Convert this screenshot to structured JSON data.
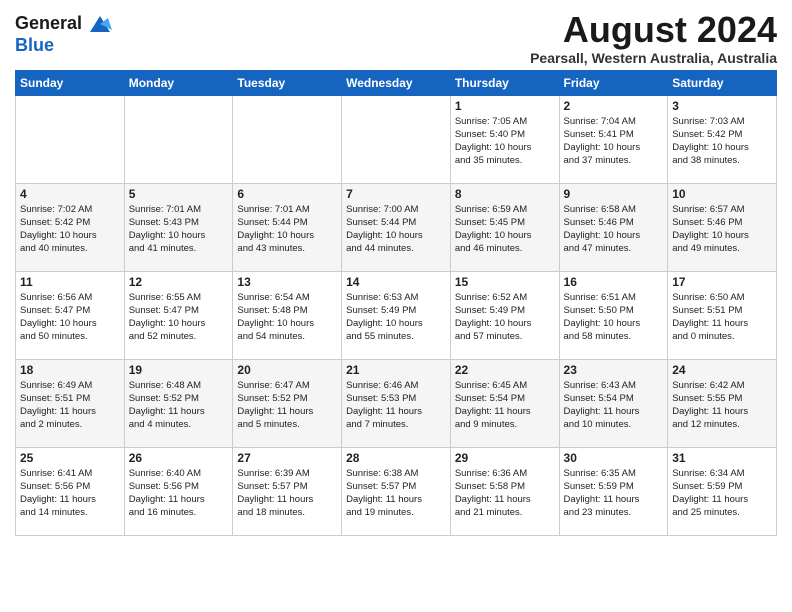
{
  "header": {
    "logo_line1": "General",
    "logo_line2": "Blue",
    "title": "August 2024",
    "subtitle": "Pearsall, Western Australia, Australia"
  },
  "days_of_week": [
    "Sunday",
    "Monday",
    "Tuesday",
    "Wednesday",
    "Thursday",
    "Friday",
    "Saturday"
  ],
  "weeks": [
    [
      {
        "day": "",
        "info": ""
      },
      {
        "day": "",
        "info": ""
      },
      {
        "day": "",
        "info": ""
      },
      {
        "day": "",
        "info": ""
      },
      {
        "day": "1",
        "info": "Sunrise: 7:05 AM\nSunset: 5:40 PM\nDaylight: 10 hours\nand 35 minutes."
      },
      {
        "day": "2",
        "info": "Sunrise: 7:04 AM\nSunset: 5:41 PM\nDaylight: 10 hours\nand 37 minutes."
      },
      {
        "day": "3",
        "info": "Sunrise: 7:03 AM\nSunset: 5:42 PM\nDaylight: 10 hours\nand 38 minutes."
      }
    ],
    [
      {
        "day": "4",
        "info": "Sunrise: 7:02 AM\nSunset: 5:42 PM\nDaylight: 10 hours\nand 40 minutes."
      },
      {
        "day": "5",
        "info": "Sunrise: 7:01 AM\nSunset: 5:43 PM\nDaylight: 10 hours\nand 41 minutes."
      },
      {
        "day": "6",
        "info": "Sunrise: 7:01 AM\nSunset: 5:44 PM\nDaylight: 10 hours\nand 43 minutes."
      },
      {
        "day": "7",
        "info": "Sunrise: 7:00 AM\nSunset: 5:44 PM\nDaylight: 10 hours\nand 44 minutes."
      },
      {
        "day": "8",
        "info": "Sunrise: 6:59 AM\nSunset: 5:45 PM\nDaylight: 10 hours\nand 46 minutes."
      },
      {
        "day": "9",
        "info": "Sunrise: 6:58 AM\nSunset: 5:46 PM\nDaylight: 10 hours\nand 47 minutes."
      },
      {
        "day": "10",
        "info": "Sunrise: 6:57 AM\nSunset: 5:46 PM\nDaylight: 10 hours\nand 49 minutes."
      }
    ],
    [
      {
        "day": "11",
        "info": "Sunrise: 6:56 AM\nSunset: 5:47 PM\nDaylight: 10 hours\nand 50 minutes."
      },
      {
        "day": "12",
        "info": "Sunrise: 6:55 AM\nSunset: 5:47 PM\nDaylight: 10 hours\nand 52 minutes."
      },
      {
        "day": "13",
        "info": "Sunrise: 6:54 AM\nSunset: 5:48 PM\nDaylight: 10 hours\nand 54 minutes."
      },
      {
        "day": "14",
        "info": "Sunrise: 6:53 AM\nSunset: 5:49 PM\nDaylight: 10 hours\nand 55 minutes."
      },
      {
        "day": "15",
        "info": "Sunrise: 6:52 AM\nSunset: 5:49 PM\nDaylight: 10 hours\nand 57 minutes."
      },
      {
        "day": "16",
        "info": "Sunrise: 6:51 AM\nSunset: 5:50 PM\nDaylight: 10 hours\nand 58 minutes."
      },
      {
        "day": "17",
        "info": "Sunrise: 6:50 AM\nSunset: 5:51 PM\nDaylight: 11 hours\nand 0 minutes."
      }
    ],
    [
      {
        "day": "18",
        "info": "Sunrise: 6:49 AM\nSunset: 5:51 PM\nDaylight: 11 hours\nand 2 minutes."
      },
      {
        "day": "19",
        "info": "Sunrise: 6:48 AM\nSunset: 5:52 PM\nDaylight: 11 hours\nand 4 minutes."
      },
      {
        "day": "20",
        "info": "Sunrise: 6:47 AM\nSunset: 5:52 PM\nDaylight: 11 hours\nand 5 minutes."
      },
      {
        "day": "21",
        "info": "Sunrise: 6:46 AM\nSunset: 5:53 PM\nDaylight: 11 hours\nand 7 minutes."
      },
      {
        "day": "22",
        "info": "Sunrise: 6:45 AM\nSunset: 5:54 PM\nDaylight: 11 hours\nand 9 minutes."
      },
      {
        "day": "23",
        "info": "Sunrise: 6:43 AM\nSunset: 5:54 PM\nDaylight: 11 hours\nand 10 minutes."
      },
      {
        "day": "24",
        "info": "Sunrise: 6:42 AM\nSunset: 5:55 PM\nDaylight: 11 hours\nand 12 minutes."
      }
    ],
    [
      {
        "day": "25",
        "info": "Sunrise: 6:41 AM\nSunset: 5:56 PM\nDaylight: 11 hours\nand 14 minutes."
      },
      {
        "day": "26",
        "info": "Sunrise: 6:40 AM\nSunset: 5:56 PM\nDaylight: 11 hours\nand 16 minutes."
      },
      {
        "day": "27",
        "info": "Sunrise: 6:39 AM\nSunset: 5:57 PM\nDaylight: 11 hours\nand 18 minutes."
      },
      {
        "day": "28",
        "info": "Sunrise: 6:38 AM\nSunset: 5:57 PM\nDaylight: 11 hours\nand 19 minutes."
      },
      {
        "day": "29",
        "info": "Sunrise: 6:36 AM\nSunset: 5:58 PM\nDaylight: 11 hours\nand 21 minutes."
      },
      {
        "day": "30",
        "info": "Sunrise: 6:35 AM\nSunset: 5:59 PM\nDaylight: 11 hours\nand 23 minutes."
      },
      {
        "day": "31",
        "info": "Sunrise: 6:34 AM\nSunset: 5:59 PM\nDaylight: 11 hours\nand 25 minutes."
      }
    ]
  ]
}
